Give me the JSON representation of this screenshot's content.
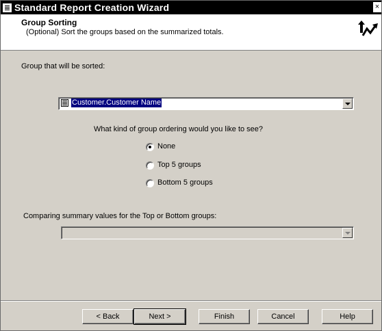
{
  "window": {
    "title": "Standard Report Creation Wizard",
    "close_glyph": "×"
  },
  "header": {
    "title": "Group Sorting",
    "subtitle": "(Optional) Sort the groups based on the summarized totals.",
    "icon": "sort-arrows-icon"
  },
  "group_section": {
    "label": "Group that will be sorted:",
    "selected_value": "Customer.Customer Name"
  },
  "ordering": {
    "question": "What kind of group ordering would you like to see?",
    "options": [
      {
        "label": "None",
        "checked": true
      },
      {
        "label": "Top 5 groups",
        "checked": false
      },
      {
        "label": "Bottom 5 groups",
        "checked": false
      }
    ]
  },
  "comparing": {
    "label": "Comparing summary values for the Top or Bottom groups:",
    "value": ""
  },
  "buttons": {
    "back": "< Back",
    "next": "Next >",
    "finish": "Finish",
    "cancel": "Cancel",
    "help": "Help"
  }
}
